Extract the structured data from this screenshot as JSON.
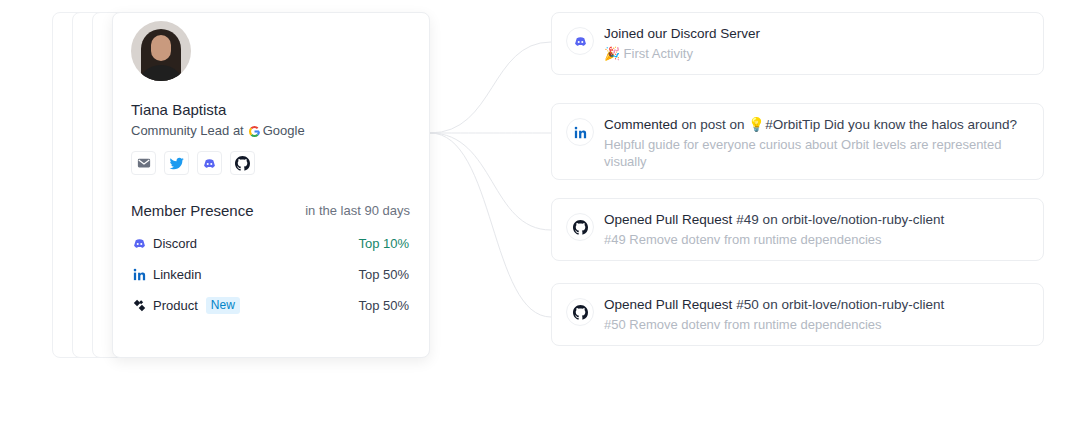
{
  "profile": {
    "name": "Tiana Baptista",
    "role": "Community Lead at",
    "company": "Google",
    "social": [
      {
        "kind": "email"
      },
      {
        "kind": "twitter"
      },
      {
        "kind": "discord"
      },
      {
        "kind": "github"
      }
    ]
  },
  "presence": {
    "title": "Member Presence",
    "period": "in the last 90 days",
    "rows": [
      {
        "kind": "discord",
        "label": "Discord",
        "rank": "Top 10%",
        "highlight": true
      },
      {
        "kind": "linkedin",
        "label": "Linkedin",
        "rank": "Top 50%",
        "highlight": false
      },
      {
        "kind": "product",
        "label": "Product",
        "badge": "New",
        "rank": "Top 50%",
        "highlight": false
      }
    ]
  },
  "activities": [
    {
      "kind": "discord",
      "action": "Joined our Discord Server",
      "subtitle": "🎉 First Activity"
    },
    {
      "kind": "linkedin",
      "action": "Commented",
      "detail": "on post on 💡#OrbitTip Did you know the halos around?",
      "subtitle": "Helpful guide for everyone curious about Orbit levels are represented visually"
    },
    {
      "kind": "github",
      "action": "Opened Pull Request",
      "detail": "#49 on orbit-love/notion-ruby-client",
      "subtitle": "#49 Remove dotenv from runtime dependencies"
    },
    {
      "kind": "github",
      "action": "Opened Pull Request",
      "detail": "#50 on orbit-love/notion-ruby-client",
      "subtitle": "#50 Remove dotenv from runtime dependencies"
    }
  ]
}
